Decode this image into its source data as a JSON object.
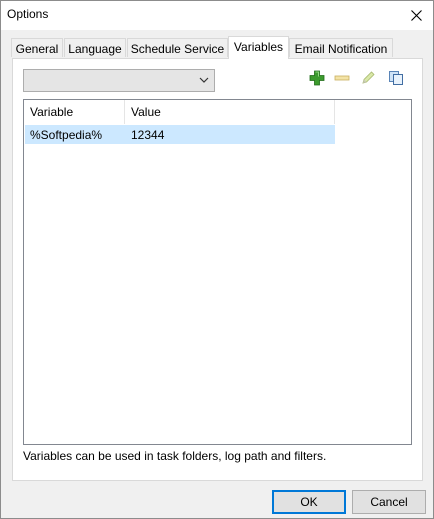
{
  "window": {
    "title": "Options"
  },
  "tabs": [
    {
      "label": "General"
    },
    {
      "label": "Language"
    },
    {
      "label": "Schedule Service"
    },
    {
      "label": "Variables",
      "active": true
    },
    {
      "label": "Email Notification"
    }
  ],
  "combo": {
    "value": ""
  },
  "toolbar": {
    "add_icon": "plus-icon",
    "remove_icon": "minus-icon",
    "edit_icon": "pencil-icon",
    "copy_icon": "copy-icon"
  },
  "list": {
    "columns": [
      "Variable",
      "Value"
    ],
    "rows": [
      {
        "variable": "%Softpedia%",
        "value": "12344",
        "selected": true
      }
    ]
  },
  "hint": "Variables can be used in task folders, log path and filters.",
  "buttons": {
    "ok": "OK",
    "cancel": "Cancel"
  },
  "colors": {
    "selection": "#cce8ff",
    "default_border": "#0078d7"
  }
}
